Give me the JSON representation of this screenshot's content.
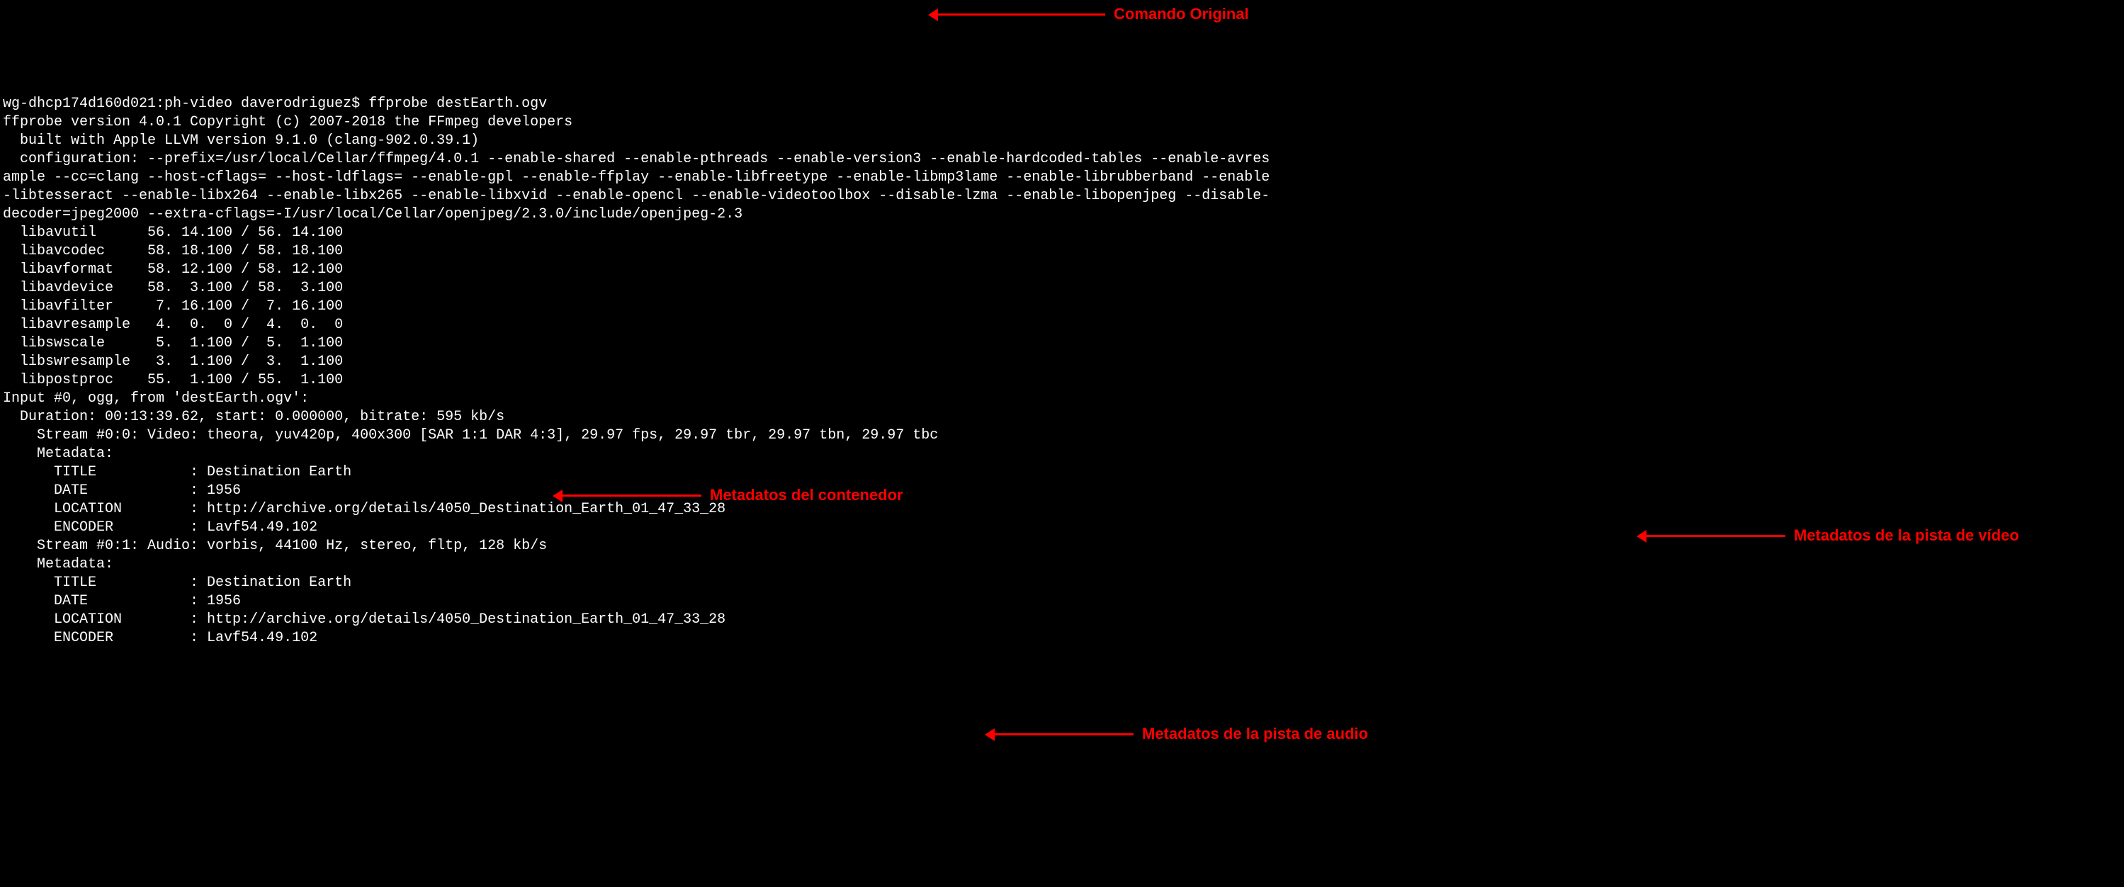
{
  "terminal": {
    "prompt": "wg-dhcp174d160d021:ph-video daverodriguez$ ",
    "command": "ffprobe destEarth.ogv",
    "line_version": "ffprobe version 4.0.1 Copyright (c) 2007-2018 the FFmpeg developers",
    "line_built": "  built with Apple LLVM version 9.1.0 (clang-902.0.39.1)",
    "line_config1": "  configuration: --prefix=/usr/local/Cellar/ffmpeg/4.0.1 --enable-shared --enable-pthreads --enable-version3 --enable-hardcoded-tables --enable-avres",
    "line_config2": "ample --cc=clang --host-cflags= --host-ldflags= --enable-gpl --enable-ffplay --enable-libfreetype --enable-libmp3lame --enable-librubberband --enable",
    "line_config3": "-libtesseract --enable-libx264 --enable-libx265 --enable-libxvid --enable-opencl --enable-videotoolbox --disable-lzma --enable-libopenjpeg --disable-",
    "line_config4": "decoder=jpeg2000 --extra-cflags=-I/usr/local/Cellar/openjpeg/2.3.0/include/openjpeg-2.3",
    "lib_avutil": "  libavutil      56. 14.100 / 56. 14.100",
    "lib_avcodec": "  libavcodec     58. 18.100 / 58. 18.100",
    "lib_avformat": "  libavformat    58. 12.100 / 58. 12.100",
    "lib_avdevice": "  libavdevice    58.  3.100 / 58.  3.100",
    "lib_avfilter": "  libavfilter     7. 16.100 /  7. 16.100",
    "lib_avresample": "  libavresample   4.  0.  0 /  4.  0.  0",
    "lib_swscale": "  libswscale      5.  1.100 /  5.  1.100",
    "lib_swresample": "  libswresample   3.  1.100 /  3.  1.100",
    "lib_postproc": "  libpostproc    55.  1.100 / 55.  1.100",
    "input_header": "Input #0, ogg, from 'destEarth.ogv':",
    "duration_line": "  Duration: 00:13:39.62, start: 0.000000, bitrate: 595 kb/s",
    "stream_video": "    Stream #0:0: Video: theora, yuv420p, 400x300 [SAR 1:1 DAR 4:3], 29.97 fps, 29.97 tbr, 29.97 tbn, 29.97 tbc",
    "metadata_label_1": "    Metadata:",
    "meta_v_title": "      TITLE           : Destination Earth",
    "meta_v_date": "      DATE            : 1956",
    "meta_v_location": "      LOCATION        : http://archive.org/details/4050_Destination_Earth_01_47_33_28",
    "meta_v_encoder": "      ENCODER         : Lavf54.49.102",
    "stream_audio": "    Stream #0:1: Audio: vorbis, 44100 Hz, stereo, fltp, 128 kb/s",
    "metadata_label_2": "    Metadata:",
    "meta_a_title": "      TITLE           : Destination Earth",
    "meta_a_date": "      DATE            : 1956",
    "meta_a_location": "      LOCATION        : http://archive.org/details/4050_Destination_Earth_01_47_33_28",
    "meta_a_encoder": "      ENCODER         : Lavf54.49.102"
  },
  "annotations": {
    "a1": "Comando Original",
    "a2": "Metadatos del contenedor",
    "a3": "Metadatos de la pista de vídeo",
    "a4": "Metadatos de la pista de audio"
  }
}
